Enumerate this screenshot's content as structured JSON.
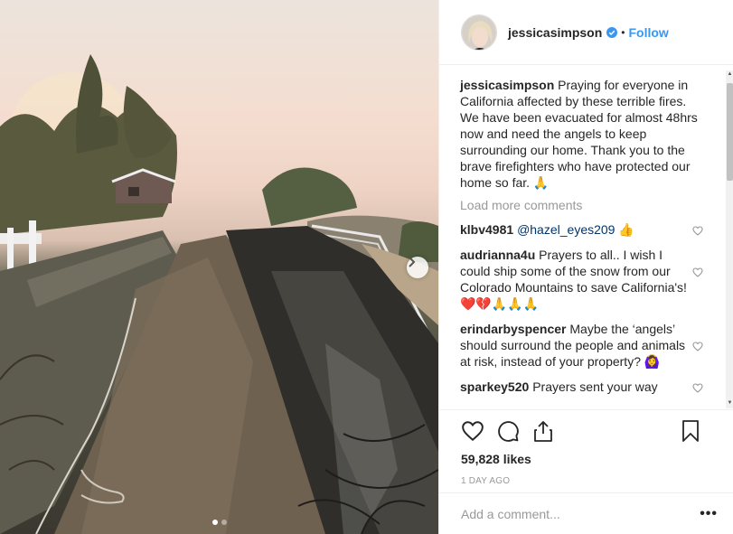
{
  "post": {
    "username": "jessicasimpson",
    "follow_label": "Follow",
    "bullet": "•",
    "caption": "Praying for everyone in California affected by these terrible fires. We have been evacuated for almost 48hrs now and need the angels to keep surrounding our home. Thank you to the brave firefighters who have protected our home so far. 🙏",
    "load_more": "Load more comments",
    "likes": "59,828 likes",
    "time": "1 DAY AGO",
    "comment_placeholder": "Add a comment...",
    "more_label": "•••"
  },
  "comments": [
    {
      "user": "klbv4981",
      "mention": "@hazel_eyes209",
      "text": " 👍"
    },
    {
      "user": "audrianna4u",
      "text": "Prayers to all.. I wish I could ship some of the snow from our Colorado Mountains to save California's! ❤️💔🙏🙏🙏"
    },
    {
      "user": "erindarbyspencer",
      "text": "Maybe the ‘angels’ should surround the people and animals at risk, instead of your property? 🙆‍♀️"
    },
    {
      "user": "sparkey520",
      "text": "Prayers sent your way"
    }
  ],
  "colors": {
    "link": "#3897f0",
    "verified": "#3897f0",
    "muted": "#999999",
    "text": "#262626"
  },
  "icons": [
    "verified-icon",
    "chevron-right-icon",
    "heart-icon",
    "comment-icon",
    "share-icon",
    "bookmark-icon",
    "more-icon"
  ]
}
